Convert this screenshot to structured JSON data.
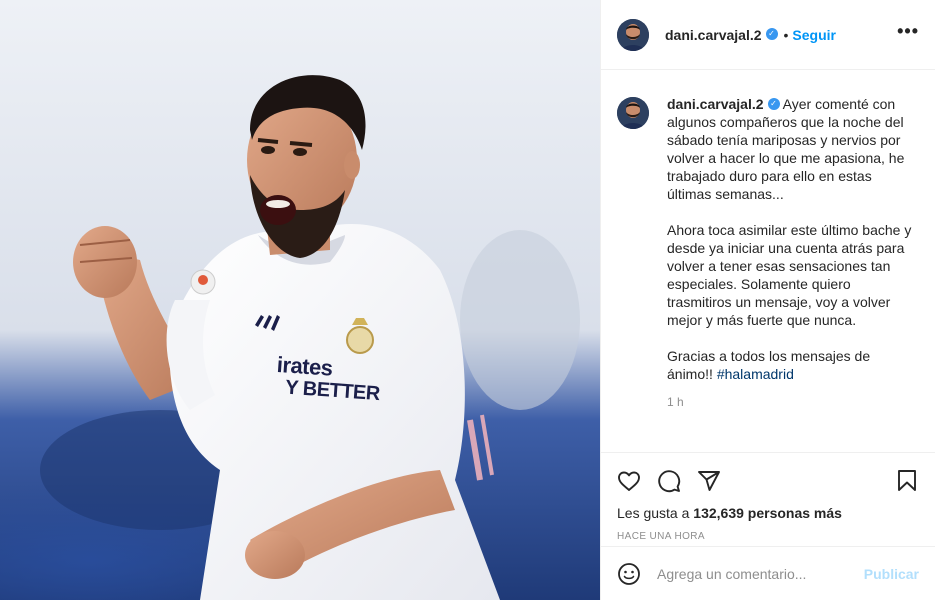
{
  "post": {
    "photo_alt_text": "",
    "photo_text": {
      "line1": "irates",
      "line2": "Y BETTER"
    }
  },
  "header": {
    "username": "dani.carvajal.2",
    "separator": "•",
    "follow_label": "Seguir",
    "more_label": "•••"
  },
  "caption": {
    "username": "dani.carvajal.2",
    "paragraph1": "Ayer comenté con algunos compañeros que la noche del sábado tenía mariposas y nervios por volver a hacer lo que me apasiona, he trabajado duro para ello en estas últimas semanas...",
    "paragraph2": "Ahora toca asimilar este último bache y desde ya iniciar una cuenta atrás para volver a tener esas sensaciones tan especiales. Solamente quiero trasmitiros un mensaje, voy a volver mejor y más fuerte que nunca.",
    "paragraph3_text": "Gracias a todos los mensajes de ánimo!! ",
    "hashtag": "#halamadrid",
    "time": "1 h"
  },
  "actions": {
    "likes_prefix": "Les gusta a ",
    "likes_count": "132,639",
    "likes_suffix": " personas más",
    "posted": "HACE UNA HORA"
  },
  "comment_box": {
    "placeholder": "Agrega un comentario...",
    "publish_label": "Publicar"
  },
  "icons": {
    "verified": "verified-badge-icon",
    "like": "heart-icon",
    "comment": "comment-icon",
    "share": "paper-plane-icon",
    "save": "bookmark-icon",
    "emoji": "smiley-icon",
    "more": "more-options-icon"
  },
  "colors": {
    "accent": "#0095f6",
    "verified": "#3897f0",
    "publish_disabled": "#b2dffc",
    "muted": "#8e8e8e",
    "hashtag": "#00376b"
  }
}
